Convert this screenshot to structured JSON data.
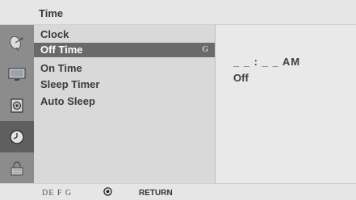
{
  "menu": {
    "title": "Time",
    "items": [
      {
        "label": "Clock",
        "selected": false,
        "key": ""
      },
      {
        "label": "Off Time",
        "selected": true,
        "key": "G"
      },
      {
        "label": "On Time",
        "selected": false,
        "key": ""
      },
      {
        "label": "Sleep Timer",
        "selected": false,
        "key": ""
      },
      {
        "label": "Auto Sleep",
        "selected": false,
        "key": ""
      }
    ]
  },
  "icons": [
    "satellite-dish-icon",
    "tv-screen-icon",
    "speaker-icon",
    "clock-icon",
    "padlock-icon"
  ],
  "active_icon": "clock-icon",
  "value_panel": {
    "time": "_ _ : _ _ AM",
    "state": "Off"
  },
  "footer": {
    "nav_keys": "DE  F  G",
    "return_label": "RETURN"
  },
  "colors": {
    "icon_column": "#8c8c8c",
    "icon_active": "#5f5f5f",
    "menu_background": "#d9d9d9",
    "selected_row": "#6a6a6a",
    "value_panel": "#e9e9e9"
  }
}
